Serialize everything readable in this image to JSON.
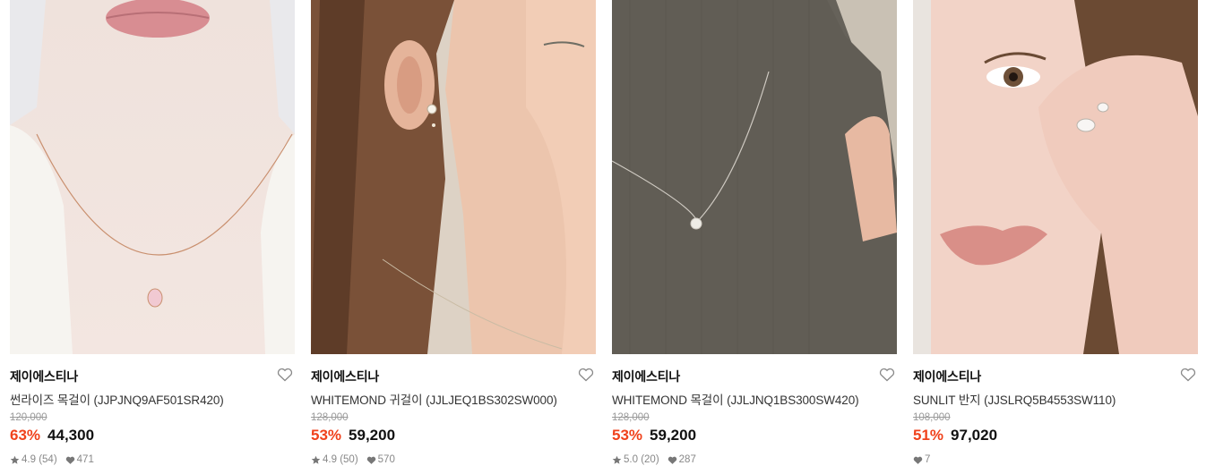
{
  "products": [
    {
      "brand": "제이에스티나",
      "title": "썬라이즈 목걸이 (JJPJNQ9AF501SR420)",
      "original_price": "120,000",
      "discount": "63%",
      "price": "44,300",
      "rating": "4.9",
      "reviews": "(54)",
      "likes": "471"
    },
    {
      "brand": "제이에스티나",
      "title": "WHITEMOND 귀걸이 (JJLJEQ1BS302SW000)",
      "original_price": "128,000",
      "discount": "53%",
      "price": "59,200",
      "rating": "4.9",
      "reviews": "(50)",
      "likes": "570"
    },
    {
      "brand": "제이에스티나",
      "title": "WHITEMOND 목걸이 (JJLJNQ1BS300SW420)",
      "original_price": "128,000",
      "discount": "53%",
      "price": "59,200",
      "rating": "5.0",
      "reviews": "(20)",
      "likes": "287"
    },
    {
      "brand": "제이에스티나",
      "title": "SUNLIT 반지 (JJSLRQ5B4553SW110)",
      "original_price": "108,000",
      "discount": "51%",
      "price": "97,020",
      "likes": "7"
    }
  ],
  "icons": {
    "favorite": "heart-outline-icon",
    "rating": "star-icon",
    "likes": "heart-filled-icon"
  },
  "colors": {
    "discount": "#f0421c",
    "muted": "#888888"
  }
}
